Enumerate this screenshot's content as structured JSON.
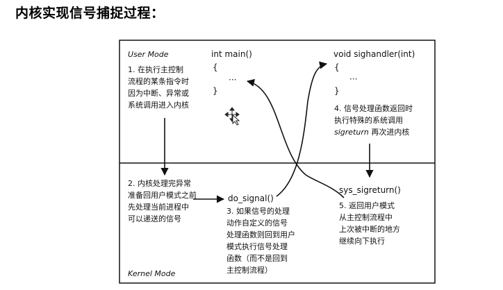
{
  "heading": "内核实现信号捕捉过程：",
  "user_mode_label": "User Mode",
  "kernel_mode_label": "Kernel Mode",
  "main_code": {
    "sig": "int main()",
    "open": "{",
    "body": "···",
    "close": "}"
  },
  "handler_code": {
    "sig": "void sighandler(int)",
    "open": "{",
    "body": "···",
    "close": "}"
  },
  "steps": {
    "s1": [
      "1. 在执行主控制",
      "流程的某条指令时",
      "因为中断、异常或",
      "系统调用进入内核"
    ],
    "s2": [
      "2. 内核处理完异常",
      "准备回用户模式之前",
      "先处理当前进程中",
      "可以递送的信号"
    ],
    "s3": [
      "3. 如果信号的处理",
      "动作自定义的信号",
      "处理函数则回到用户",
      "模式执行信号处理",
      "函数（而不是回到",
      "主控制流程）"
    ],
    "s4_lines": [
      "4. 信号处理函数返回时",
      "执行特殊的系统调用"
    ],
    "s4_italic": "sigreturn",
    "s4_tail": "再次进内核",
    "s5": [
      "5. 返回用户模式",
      "从主控制流程中",
      "上次被中断的地方",
      "继续向下执行"
    ]
  },
  "do_signal_label": "do_signal()",
  "sys_sigreturn_label": "sys_sigreturn()",
  "cursor_icon": "move-cursor-icon"
}
